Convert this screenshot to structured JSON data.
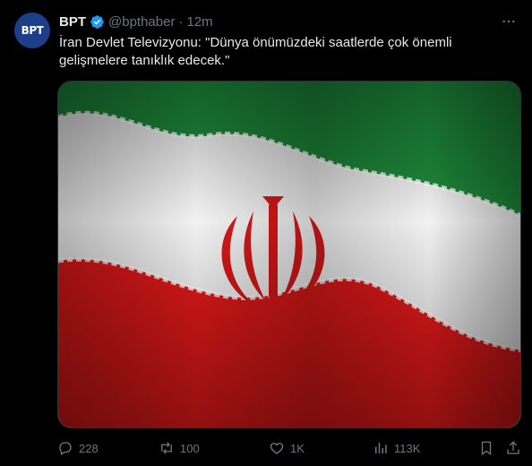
{
  "author": {
    "avatar_text": "BPT",
    "name": "BPT",
    "handle": "@bpthaber",
    "separator": "·",
    "time": "12m"
  },
  "tweet": {
    "text": "İran Devlet Televizyonu: \"Dünya önümüzdeki saatlerde çok önemli\ngelişmelere tanıklık edecek.\""
  },
  "actions": {
    "replies": "228",
    "retweets": "100",
    "likes": "1K",
    "views": "113K"
  },
  "colors": {
    "background": "#000000",
    "text": "#e7e9ea",
    "muted": "#71767b",
    "verified": "#1d9bf0",
    "flag_green": "#239f40",
    "flag_white": "#f0f0f0",
    "flag_red": "#da0000"
  },
  "icons": {
    "more": "more-horizontal-icon",
    "verified": "verified-badge-icon",
    "reply": "reply-icon",
    "retweet": "retweet-icon",
    "like": "heart-icon",
    "views": "analytics-icon",
    "bookmark": "bookmark-icon",
    "share": "share-icon"
  }
}
